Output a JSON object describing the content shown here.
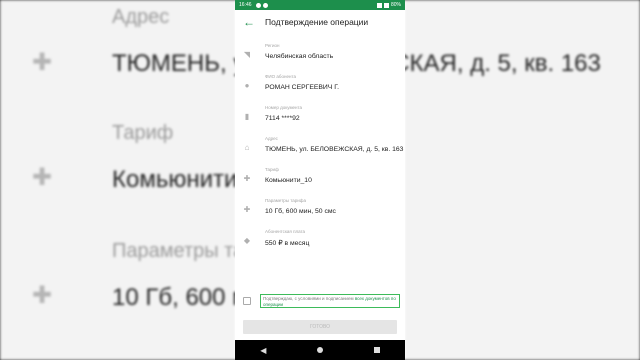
{
  "background": {
    "address_label": "Адрес",
    "address_value": "ТЮМЕНЬ, ул. БЕЛОВЕЖСКАЯ, д. 5, кв. 163",
    "tariff_label": "Тариф",
    "tariff_value": "Комьюнити_10",
    "params_label": "Параметры тарифа",
    "params_value": "10 Гб, 600 мин, 50 смс"
  },
  "status_bar": {
    "time": "16:46",
    "battery": "80%"
  },
  "header": {
    "title": "Подтверждение операции"
  },
  "fields": [
    {
      "icon": "location-icon",
      "label": "Регион",
      "value": "Челябинская область"
    },
    {
      "icon": "person-icon",
      "label": "ФИО абонента",
      "value": "РОМАН СЕРГЕЕВИЧ Г."
    },
    {
      "icon": "phone-icon",
      "label": "Номер документа",
      "value": "7114 ****92"
    },
    {
      "icon": "home-icon",
      "label": "Адрес",
      "value": "ТЮМЕНЬ, ул. БЕЛОВЕЖСКАЯ, д. 5, кв. 163"
    },
    {
      "icon": "plus-icon",
      "label": "Тариф",
      "value": "Комьюнити_10"
    },
    {
      "icon": "plus-icon",
      "label": "Параметры тарифа",
      "value": "10 Гб, 600 мин, 50 смс"
    },
    {
      "icon": "coins-icon",
      "label": "Абонентская плата",
      "value": "550 ₽ в месяц"
    }
  ],
  "consent": {
    "text": "Подтверждаю, с условиями и подписанием",
    "link": "всех документов по операции"
  },
  "confirm_button": {
    "label": "ГОТОВО"
  }
}
